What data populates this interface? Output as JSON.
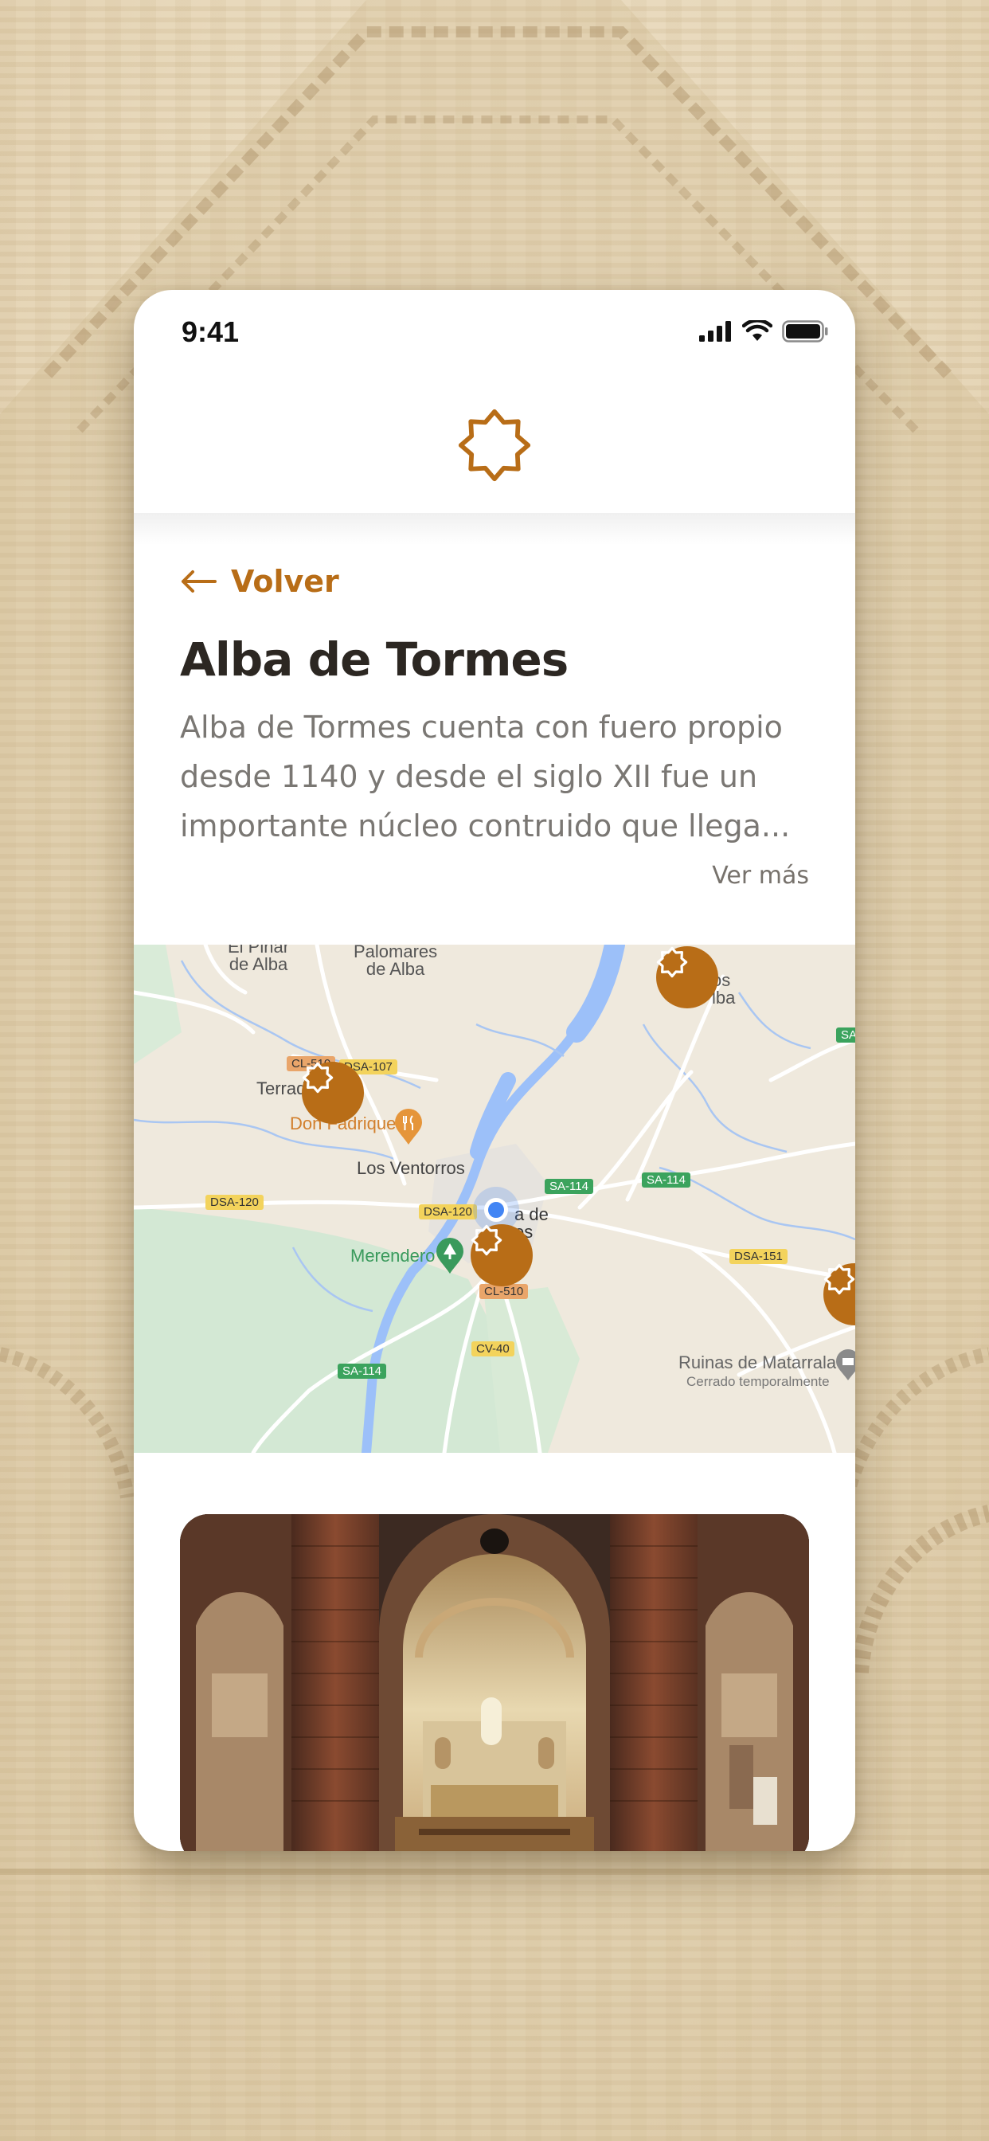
{
  "status_bar": {
    "time": "9:41",
    "icons": [
      "cellular-signal-icon",
      "wifi-icon",
      "battery-icon"
    ]
  },
  "header": {
    "logo": "eight-point-star-icon"
  },
  "navigation": {
    "back_label": "Volver",
    "back_icon": "arrow-left-icon"
  },
  "place": {
    "title": "Alba de Tormes",
    "description": "Alba de Tormes cuenta con fuero propio desde 1140 y desde el siglo XII fue un importante núcleo contruido que llega...",
    "more_label": "Ver más"
  },
  "map": {
    "labels": {
      "el_pinar": "El Pinar\nde Alba",
      "palomares": "Palomares\nde Alba",
      "terradillos": "Terrad",
      "don_fadrique": "Don Fadrique",
      "los_ventorros": "Los Ventorros",
      "alba": "a de\nes",
      "merendero": "Merendero",
      "ruinas": "Ruinas de Matarrala",
      "ruinas_status": "Cerrado temporalmente",
      "os_alba": "os\nlba"
    },
    "roads": {
      "cl510_top": "CL-510",
      "dsa107": "DSA-107",
      "dsa120_left": "DSA-120",
      "dsa120_center": "DSA-120",
      "sa114_center": "SA-114",
      "sa114_right": "SA-114",
      "sa114_bottom": "SA-114",
      "dsa151": "DSA-151",
      "cl510_bottom": "CL-510",
      "cv40": "CV-40",
      "sa_edge": "SA"
    },
    "colors": {
      "marker": "#b86d17",
      "water": "#9cc0f9",
      "park": "#cfe6d0",
      "my_location": "#4285f4"
    }
  },
  "theme": {
    "accent": "#b86d17",
    "title_color": "#2c2722",
    "text_color": "#7a7773"
  }
}
